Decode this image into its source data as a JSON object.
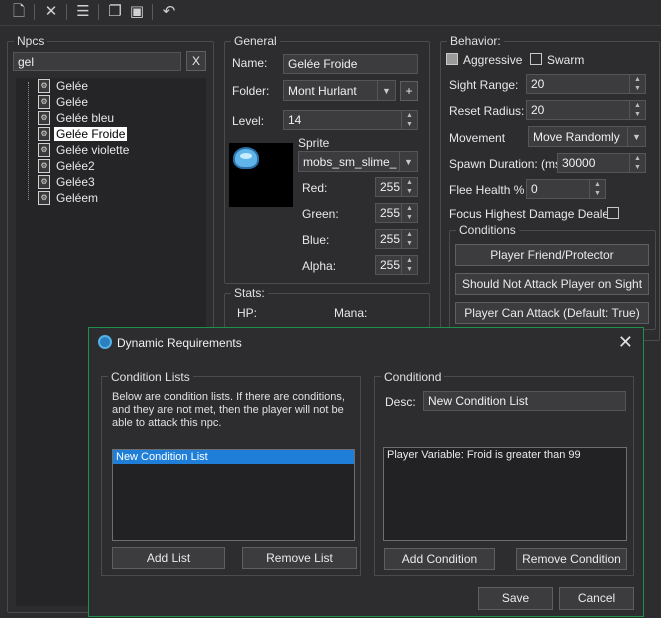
{
  "toolbar": {
    "icons": [
      "new-item-icon",
      "delete-icon",
      "list-icon",
      "copy-icon",
      "paste-icon",
      "undo-icon"
    ]
  },
  "npcs": {
    "title": "Npcs",
    "search_value": "gel",
    "clear_label": "X",
    "items": [
      "Gelée",
      "Gelée",
      "Gelée bleu",
      "Gelée Froide",
      "Gelée violette",
      "Gelée2",
      "Gelée3",
      "Geléem"
    ],
    "selected_index": 3
  },
  "general": {
    "title": "General",
    "name_label": "Name:",
    "name_value": "Gelée Froide",
    "folder_label": "Folder:",
    "folder_value": "Mont Hurlant",
    "add_folder_label": "+",
    "level_label": "Level:",
    "level_value": "14",
    "sprite_label": "Sprite",
    "sprite_value": "mobs_sm_slime_",
    "red_label": "Red:",
    "red_value": "255",
    "green_label": "Green:",
    "green_value": "255",
    "blue_label": "Blue:",
    "blue_value": "255",
    "alpha_label": "Alpha:",
    "alpha_value": "255"
  },
  "stats": {
    "title": "Stats:",
    "hp_label": "HP:",
    "mana_label": "Mana:"
  },
  "behavior": {
    "title": "Behavior:",
    "aggressive_label": "Aggressive",
    "aggressive_checked": true,
    "swarm_label": "Swarm",
    "swarm_checked": false,
    "sight_range_label": "Sight Range:",
    "sight_range_value": "20",
    "reset_radius_label": "Reset Radius:",
    "reset_radius_value": "20",
    "movement_label": "Movement",
    "movement_value": "Move Randomly",
    "spawn_duration_label": "Spawn Duration: (ms)",
    "spawn_duration_value": "30000",
    "flee_health_label": "Flee Health %",
    "flee_health_value": "0",
    "focus_label": "Focus Highest Damage Dealer:",
    "focus_checked": false,
    "conditions_title": "Conditions",
    "btn_friend": "Player Friend/Protector",
    "btn_should_not": "Should Not Attack Player on Sight",
    "btn_can_attack": "Player Can Attack (Default: True)"
  },
  "dialog": {
    "title": "Dynamic Requirements",
    "close": "✕",
    "condition_lists_title": "Condition Lists",
    "description": "Below are condition lists. If there are conditions, and they are not met, then the player will not be able to attack this npc.",
    "lists": [
      "New Condition List"
    ],
    "add_list": "Add List",
    "remove_list": "Remove List",
    "conditiond_title": "Conditiond",
    "desc_label": "Desc:",
    "desc_value": "New Condition List",
    "conditions": [
      "Player Variable: Froid is greater than 99"
    ],
    "add_condition": "Add Condition",
    "remove_condition": "Remove Condition",
    "save": "Save",
    "cancel": "Cancel"
  }
}
